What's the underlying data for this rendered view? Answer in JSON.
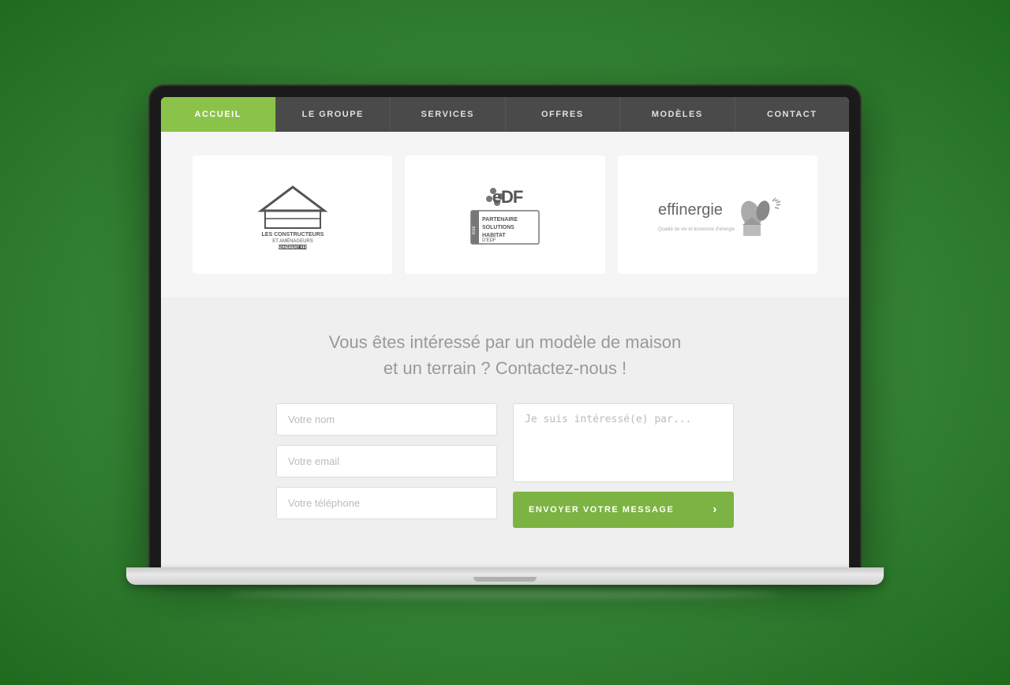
{
  "background": {
    "color_start": "#5cb85c",
    "color_end": "#1e6b1e"
  },
  "nav": {
    "items": [
      {
        "label": "ACCUEIL",
        "active": true
      },
      {
        "label": "LE GROUPE",
        "active": false
      },
      {
        "label": "SERVICES",
        "active": false
      },
      {
        "label": "OFFRES",
        "active": false
      },
      {
        "label": "MODÈLES",
        "active": false
      },
      {
        "label": "CONTACT",
        "active": false
      }
    ]
  },
  "logos": [
    {
      "name": "constructeurs-ffb",
      "alt": "Les Constructeurs et Aménageurs - FFB"
    },
    {
      "name": "edf-partenaire",
      "alt": "EDF Partenaire Solutions Habitat"
    },
    {
      "name": "effinergie",
      "alt": "Effinergie"
    }
  ],
  "contact": {
    "title_line1": "Vous êtes intéressé par un modèle de maison",
    "title_line2": "et un terrain ? Contactez-nous !",
    "fields": {
      "name_placeholder": "Votre nom",
      "email_placeholder": "Votre email",
      "phone_placeholder": "Votre téléphone",
      "message_placeholder": "Je suis intéressé(e) par..."
    },
    "submit_label": "ENVOYER VOTRE MESSAGE",
    "submit_arrow": "›"
  }
}
